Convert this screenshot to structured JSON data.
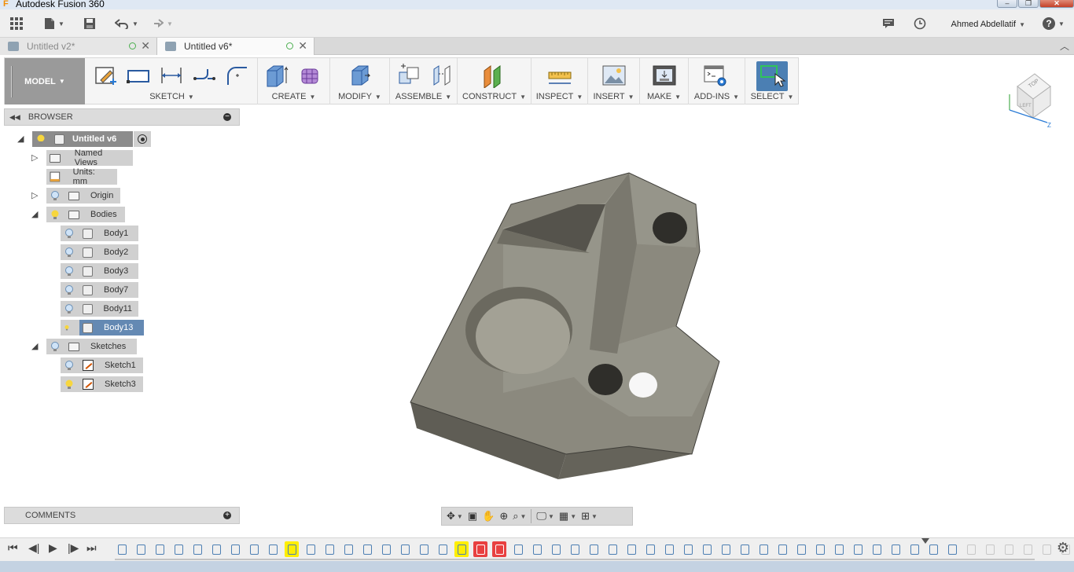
{
  "window": {
    "title": "Autodesk Fusion 360",
    "logo": "F"
  },
  "qab": {
    "user": "Ahmed Abdellatif",
    "help": "?"
  },
  "tabs": [
    {
      "label": "Untitled v2*",
      "state": "inactive"
    },
    {
      "label": "Untitled v6*",
      "state": "active"
    }
  ],
  "ribbon": {
    "workspace": "MODEL",
    "groups": [
      {
        "label": "SKETCH"
      },
      {
        "label": "CREATE"
      },
      {
        "label": "MODIFY"
      },
      {
        "label": "ASSEMBLE"
      },
      {
        "label": "CONSTRUCT"
      },
      {
        "label": "INSPECT"
      },
      {
        "label": "INSERT"
      },
      {
        "label": "MAKE"
      },
      {
        "label": "ADD-INS"
      },
      {
        "label": "SELECT"
      }
    ]
  },
  "browser": {
    "title": "BROWSER",
    "root": "Untitled v6",
    "named_views": "Named Views",
    "units": "Units: mm",
    "origin": "Origin",
    "bodies": "Bodies",
    "body_items": [
      "Body1",
      "Body2",
      "Body3",
      "Body7",
      "Body11",
      "Body13"
    ],
    "sketches": "Sketches",
    "sketch_items": [
      "Sketch1",
      "Sketch3"
    ]
  },
  "comments": {
    "title": "COMMENTS"
  },
  "viewcube": {
    "top": "TOP",
    "left": "LEFT"
  },
  "colors": {
    "accent_blue": "#6489b3",
    "highlight_yellow": "#ffee00",
    "highlight_red": "#e84040",
    "model_gray": "#6f6d63"
  }
}
